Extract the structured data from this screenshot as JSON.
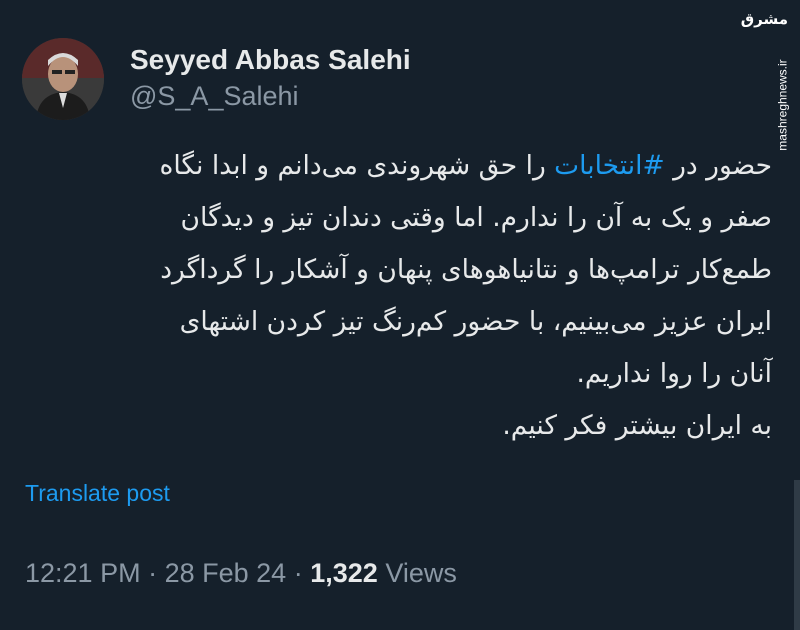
{
  "author": {
    "name": "Seyyed Abbas Salehi",
    "handle": "@S_A_Salehi"
  },
  "tweet": {
    "lines": [
      {
        "pre": "حضور در ",
        "hashtag": "#انتخابات",
        "post": " را حق شهروندی می‌دانم و ابدا نگاه"
      },
      {
        "text": "صفر و یک به آن را ندارم. اما وقتی دندان تیز و  دیدگان"
      },
      {
        "text": "طمع‌کار ترامپ‌ها و نتانیاهوهای پنهان و آشکار را گرداگرد"
      },
      {
        "text": "ایران عزیز می‌بینیم، با حضور کم‌رنگ  تیز کردن اشتهای"
      },
      {
        "text": "آنان را روا نداریم."
      },
      {
        "text": "به ایران بیشتر فکر کنیم."
      }
    ],
    "translate_label": "Translate post",
    "time": "12:21 PM",
    "separator": "·",
    "date": "28 Feb 24",
    "views_count": "1,322",
    "views_label": "Views"
  },
  "watermark": {
    "logo": "مشرق",
    "url": "mashreghnews.ir"
  },
  "colors": {
    "background": "#15202b",
    "text": "#e7e9ea",
    "secondary": "#8b98a5",
    "link": "#1d9bf0"
  }
}
